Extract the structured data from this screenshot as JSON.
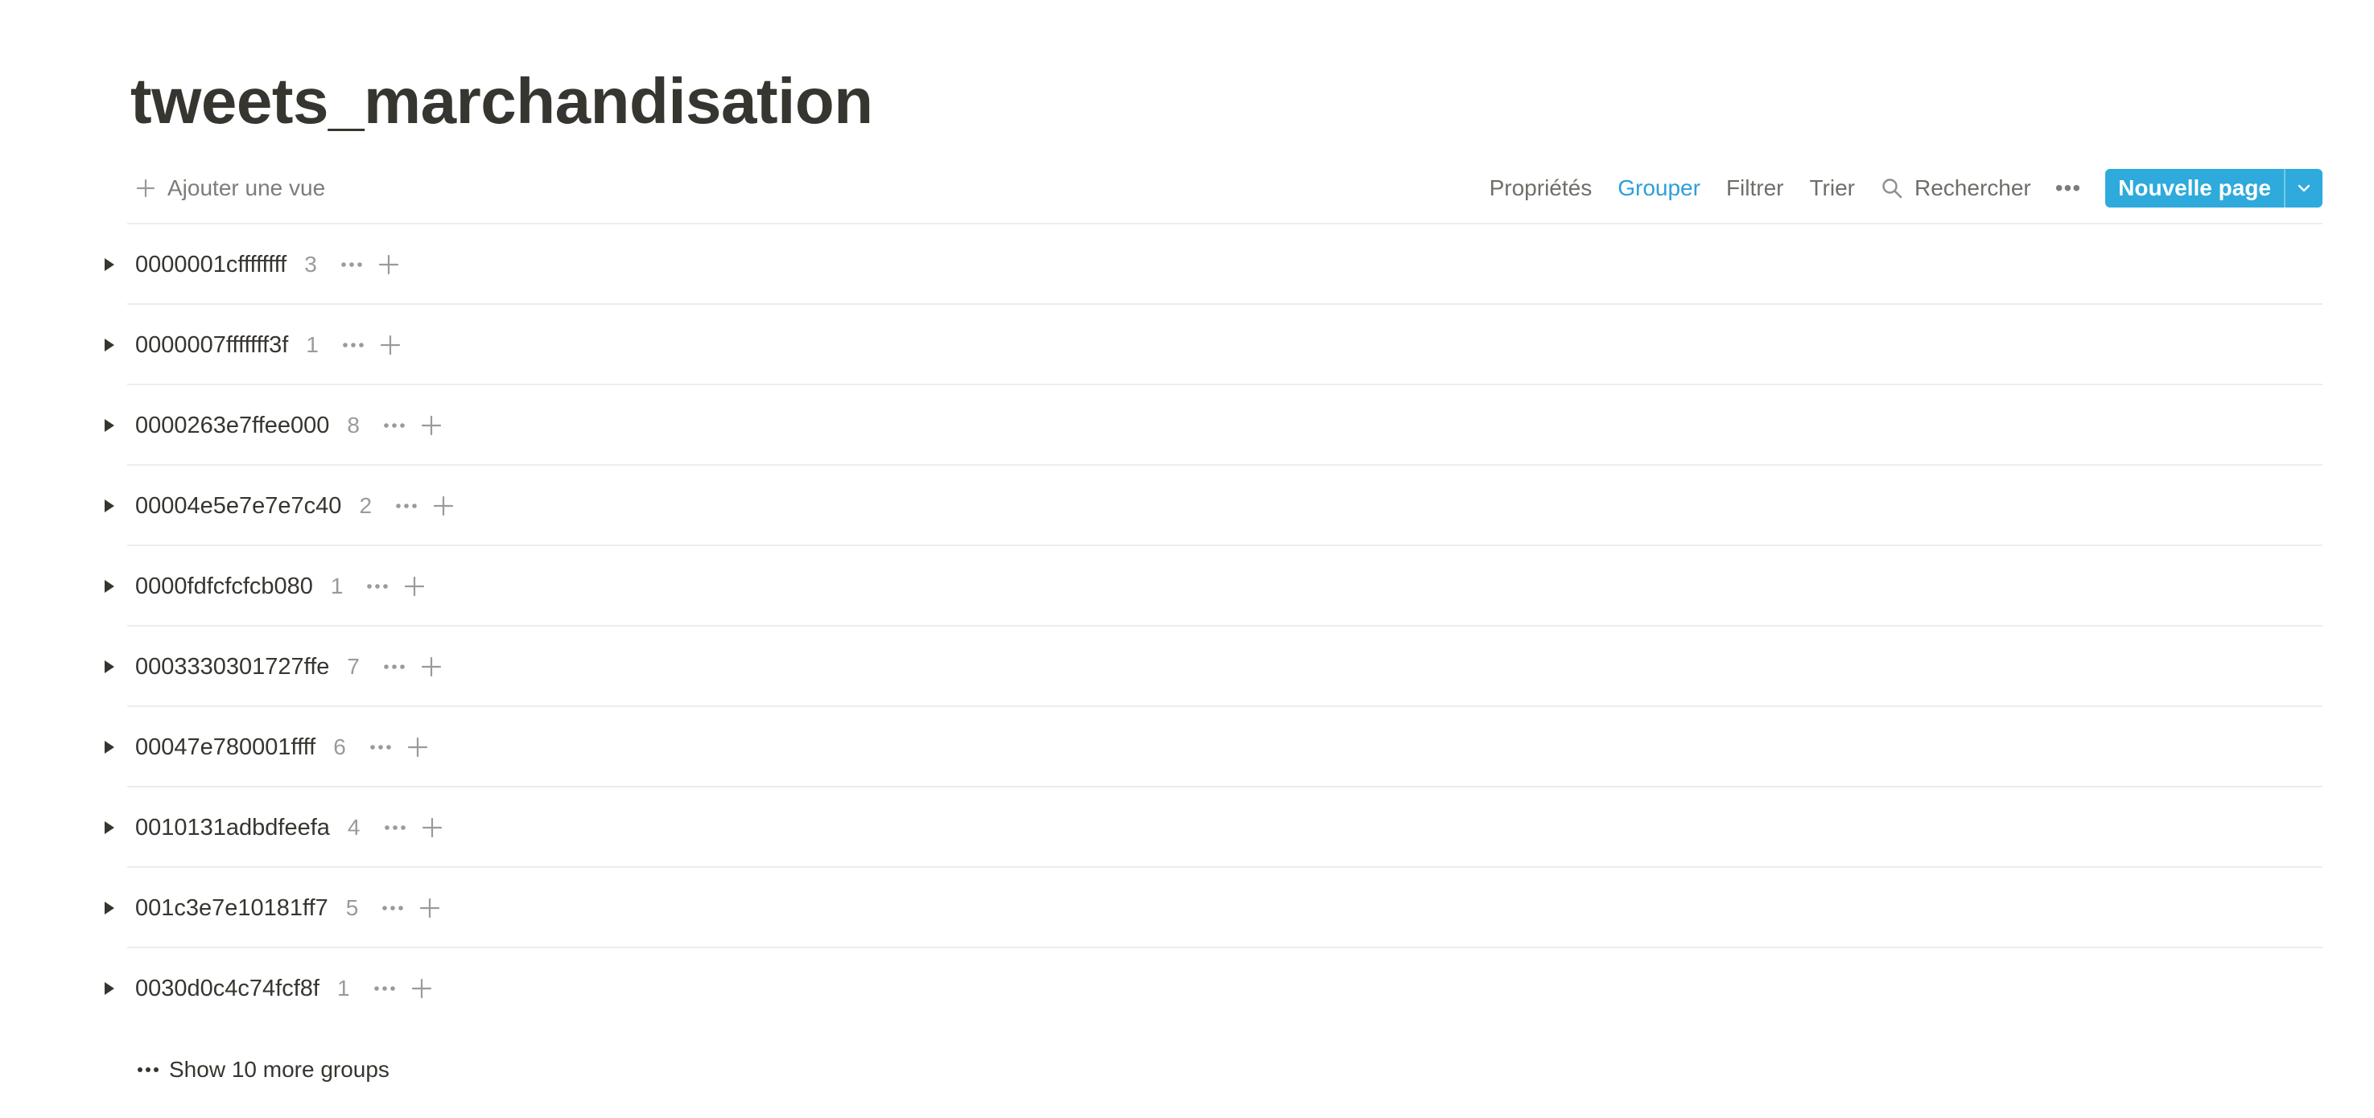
{
  "page": {
    "title": "tweets_marchandisation"
  },
  "toolbar": {
    "add_view_label": "Ajouter une vue",
    "properties_label": "Propriétés",
    "group_label": "Grouper",
    "filter_label": "Filtrer",
    "sort_label": "Trier",
    "search_label": "Rechercher",
    "more_label": "•••",
    "new_page_label": "Nouvelle page",
    "active_item": "Grouper",
    "accent_color": "#2eaadc"
  },
  "groups": [
    {
      "name": "0000001cffffffff",
      "count": "3"
    },
    {
      "name": "0000007fffffff3f",
      "count": "1"
    },
    {
      "name": "0000263e7ffee000",
      "count": "8"
    },
    {
      "name": "00004e5e7e7e7c40",
      "count": "2"
    },
    {
      "name": "0000fdfcfcfcb080",
      "count": "1"
    },
    {
      "name": "0003330301727ffe",
      "count": "7"
    },
    {
      "name": "00047e780001ffff",
      "count": "6"
    },
    {
      "name": "0010131adbdfeefa",
      "count": "4"
    },
    {
      "name": "001c3e7e10181ff7",
      "count": "5"
    },
    {
      "name": "0030d0c4c74fcf8f",
      "count": "1"
    }
  ],
  "show_more": {
    "label": "Show 10 more groups"
  }
}
